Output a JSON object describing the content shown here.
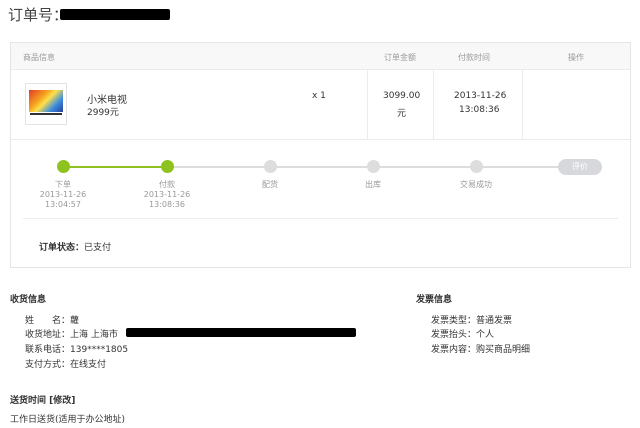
{
  "order": {
    "label": "订单号："
  },
  "table": {
    "headers": {
      "product": "商品信息",
      "amount": "订单金额",
      "pay_time": "付款时间",
      "actions": "操作"
    },
    "row": {
      "product_name": "小米电视",
      "product_price": "2999元",
      "quantity": "x 1",
      "amount_line1": "3099.00",
      "amount_line2": "元",
      "pay_date": "2013-11-26",
      "pay_clock": "13:08:36"
    }
  },
  "progress": {
    "steps": [
      {
        "label": "下单",
        "date": "2013-11-26",
        "time": "13:04:57",
        "done": true
      },
      {
        "label": "付款",
        "date": "2013-11-26",
        "time": "13:08:36",
        "done": true
      },
      {
        "label": "配货",
        "date": "",
        "time": "",
        "done": false
      },
      {
        "label": "出库",
        "date": "",
        "time": "",
        "done": false
      },
      {
        "label": "交易成功",
        "date": "",
        "time": "",
        "done": false
      }
    ],
    "evaluate_label": "评价",
    "colors": {
      "done": "#8dc21f",
      "pending": "#dddddd"
    }
  },
  "status": {
    "label": "订单状态：",
    "value": "已支付"
  },
  "shipping": {
    "title": "收货信息",
    "name_label": "姓　　名：",
    "name_value": "蘿",
    "address_label": "收货地址：",
    "address_value": "上海 上海市",
    "phone_label": "联系电话：",
    "phone_value": "139****1805",
    "payment_label": "支付方式：",
    "payment_value": "在线支付"
  },
  "invoice": {
    "title": "发票信息",
    "type_label": "发票类型：",
    "type_value": "普通发票",
    "header_label": "发票抬头：",
    "header_value": "个人",
    "content_label": "发票内容：",
    "content_value": "购买商品明细"
  },
  "delivery": {
    "title": "送货时间",
    "edit_label": "[修改]",
    "value": "工作日送货(适用于办公地址)"
  }
}
